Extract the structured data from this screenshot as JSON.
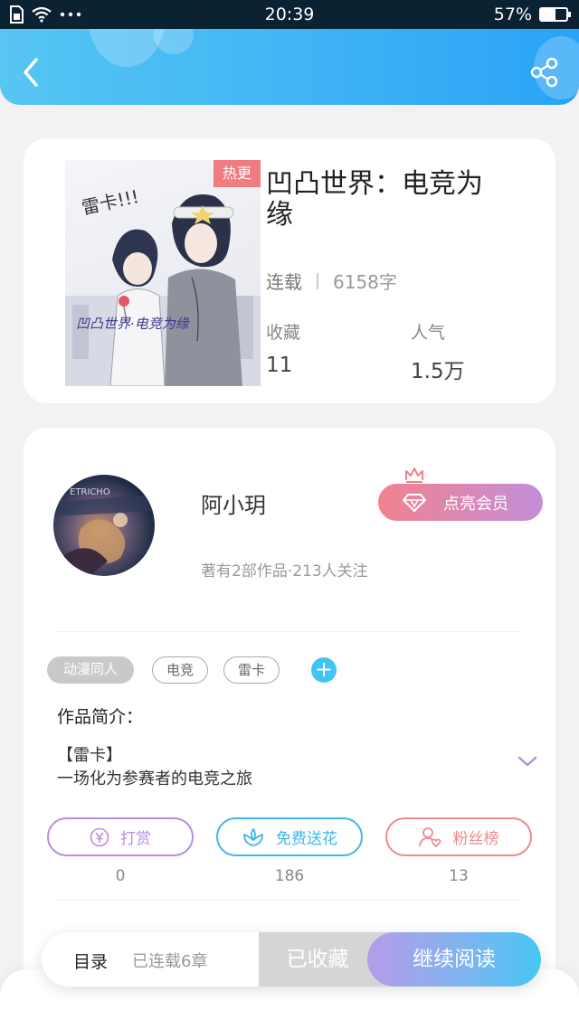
{
  "status_bar": {
    "time": "20:39",
    "battery": "57%",
    "battery_level": 0.57
  },
  "header": {
    "back_icon": "chevron-left-icon",
    "share_icon": "share-icon"
  },
  "book": {
    "badge": "热更",
    "title_line1": "凹凸世界：电竞为",
    "title_line2": "缘",
    "status": "连载",
    "word_count": "6158字",
    "favorites_label": "收藏",
    "favorites_value": "11",
    "popularity_label": "人气",
    "popularity_value": "1.5万",
    "cover_text": "雷卡!!!",
    "cover_subtitle": "凹凸世界·电竞为缘"
  },
  "author": {
    "name": "阿小玥",
    "meta": "著有2部作品·213人关注",
    "vip_label": "点亮会员",
    "avatar_text": "ETRICHO"
  },
  "tags": [
    "动漫同人",
    "电竞",
    "雷卡"
  ],
  "intro": {
    "heading": "作品简介：",
    "line1": "【雷卡】",
    "line2": "一场化为参赛者的电竞之旅"
  },
  "actions": [
    {
      "label": "打赏",
      "count": "0",
      "color": "#b78ee0",
      "icon": "yen-coin-icon"
    },
    {
      "label": "免费送花",
      "count": "186",
      "color": "#3fb8ea",
      "icon": "flower-icon"
    },
    {
      "label": "粉丝榜",
      "count": "13",
      "color": "#ee8a8d",
      "icon": "user-heart-icon"
    }
  ],
  "bottom_bar": {
    "toc_label": "目录",
    "chapters_label": "已连载6章",
    "collected_label": "已收藏",
    "read_label": "继续阅读"
  }
}
